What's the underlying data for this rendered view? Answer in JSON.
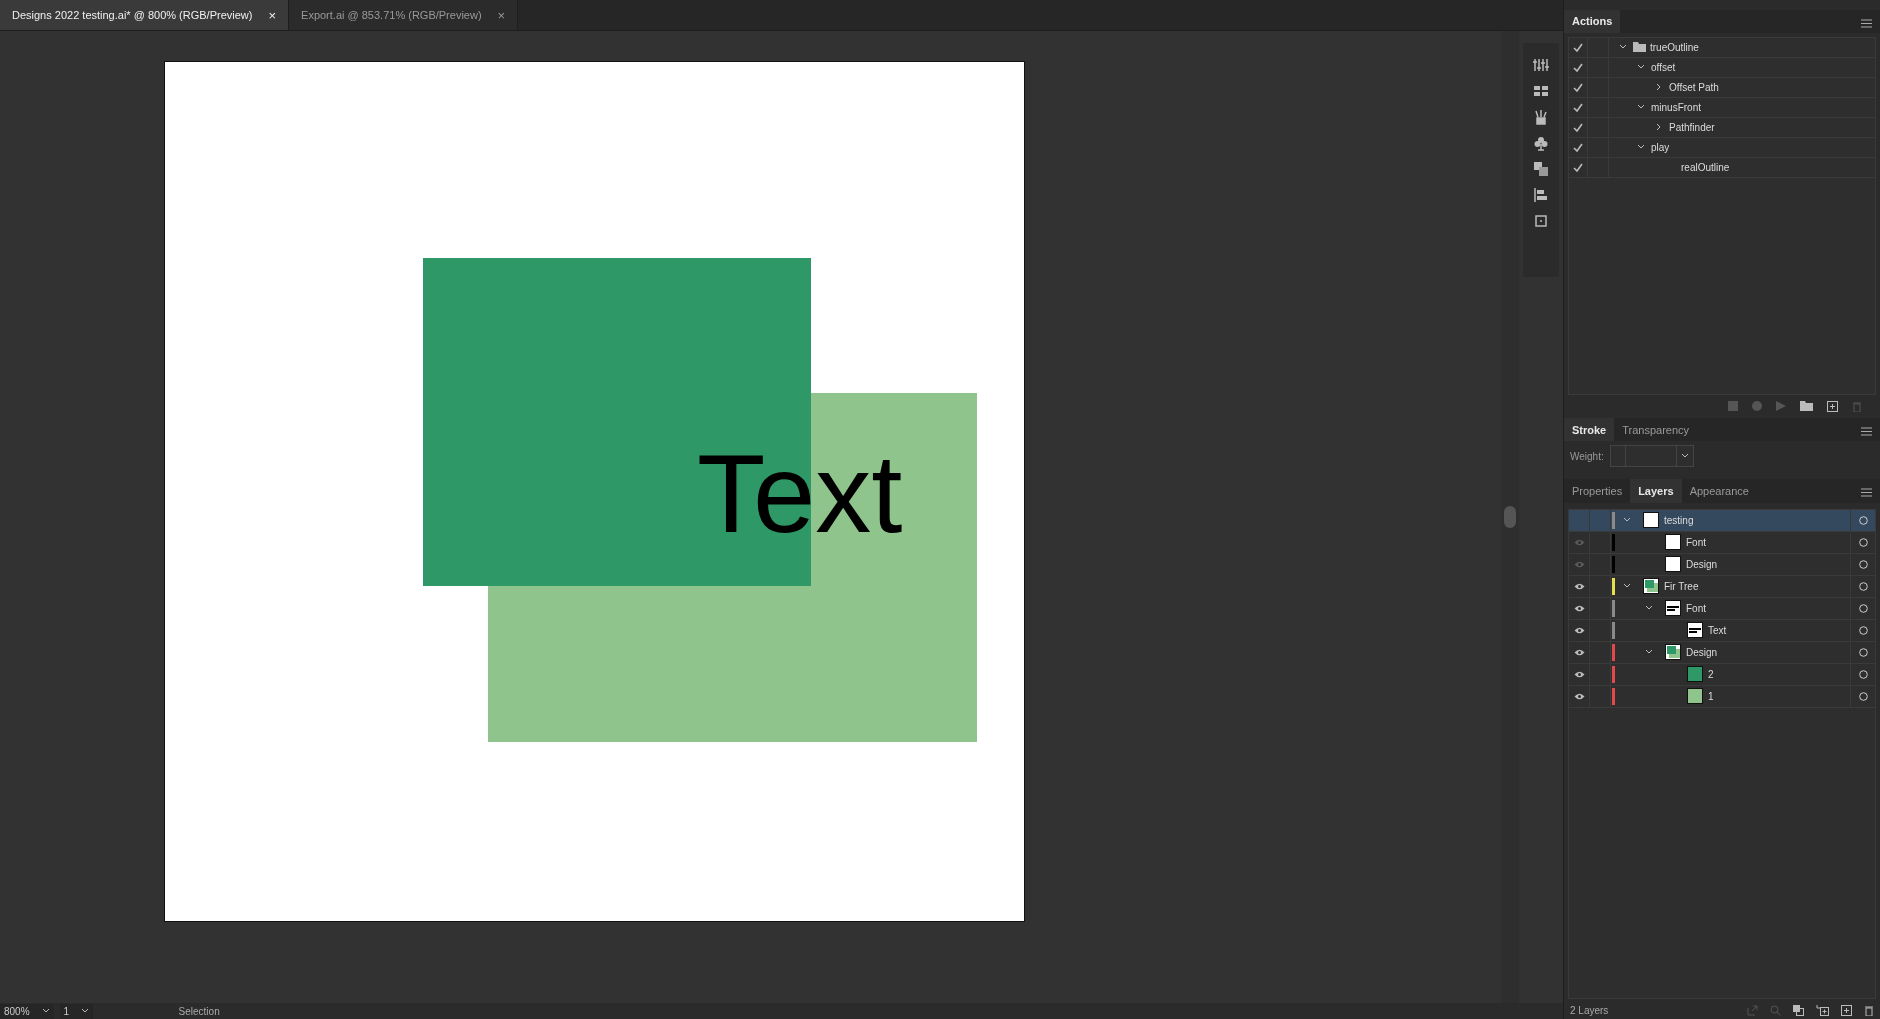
{
  "tabs": [
    {
      "label": "Designs 2022 testing.ai* @ 800% (RGB/Preview)",
      "selected": true,
      "close": "×"
    },
    {
      "label": "Export.ai @ 853.71% (RGB/Preview)",
      "selected": false,
      "close": "×"
    }
  ],
  "artboard": {
    "objects": [
      {
        "kind": "rect",
        "color": "#8fc48c"
      },
      {
        "kind": "rect",
        "color": "#2e9966"
      },
      {
        "kind": "text",
        "text": "Text",
        "color": "#000000"
      }
    ]
  },
  "actions": {
    "title": "Actions",
    "items": [
      {
        "label": "trueOutline",
        "checked": true,
        "folder": true,
        "expanded": true,
        "children": [
          {
            "label": "offset",
            "checked": true,
            "expanded": true,
            "children": [
              {
                "label": "Offset Path",
                "checked": true,
                "expanded": false
              }
            ]
          },
          {
            "label": "minusFront",
            "checked": true,
            "expanded": true,
            "children": [
              {
                "label": "Pathfinder",
                "checked": true,
                "expanded": false
              }
            ]
          },
          {
            "label": "play",
            "checked": true,
            "expanded": true,
            "children": [
              {
                "label": "realOutline",
                "checked": true
              }
            ]
          }
        ]
      }
    ]
  },
  "stroke_panel": {
    "tabs": [
      {
        "label": "Stroke",
        "selected": true
      },
      {
        "label": "Transparency",
        "selected": false
      }
    ],
    "weight_label": "Weight:"
  },
  "layers_panel": {
    "tabs": [
      {
        "label": "Properties",
        "selected": false
      },
      {
        "label": "Layers",
        "selected": true
      },
      {
        "label": "Appearance",
        "selected": false
      }
    ],
    "layers": [
      {
        "name": "testing",
        "visible": false,
        "color": "#8a8a8a",
        "kind": "blank",
        "selected": true,
        "expanded": true,
        "children": [
          {
            "name": "Font",
            "visible": true,
            "color": "#000000",
            "kind": "blank",
            "selected": false
          },
          {
            "name": "Design",
            "visible": true,
            "color": "#000000",
            "kind": "blank",
            "selected": false
          }
        ]
      },
      {
        "name": "Fir Tree",
        "visible": true,
        "color": "#e8e04a",
        "kind": "group",
        "selected": false,
        "expanded": true,
        "children": [
          {
            "name": "Font",
            "visible": true,
            "color": "#8a8a8a",
            "kind": "text",
            "selected": false,
            "expanded": true,
            "children": [
              {
                "name": "Text",
                "visible": true,
                "color": "#8a8a8a",
                "kind": "text",
                "selected": false
              }
            ]
          },
          {
            "name": "Design",
            "visible": true,
            "color": "#e04a4a",
            "kind": "group",
            "selected": false,
            "expanded": true,
            "children": [
              {
                "name": "2",
                "visible": true,
                "color": "#e04a4a",
                "kind": "dark",
                "selected": false
              },
              {
                "name": "1",
                "visible": true,
                "color": "#e04a4a",
                "kind": "light",
                "selected": false
              }
            ]
          }
        ]
      }
    ],
    "count": "2 Layers"
  },
  "status_bar": {
    "zoom": "800%",
    "artboard": "1",
    "tool": "Selection"
  }
}
